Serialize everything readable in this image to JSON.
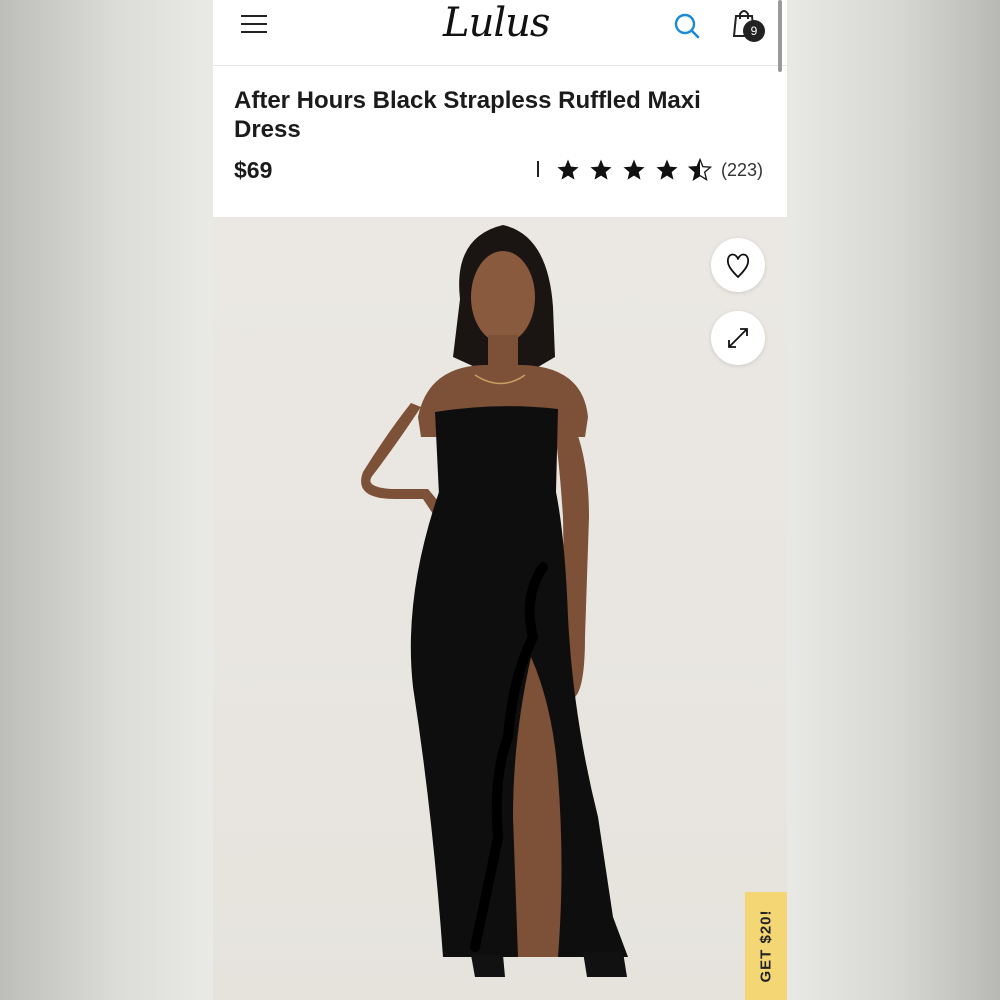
{
  "header": {
    "logo_text": "Lulus",
    "menu_icon": "hamburger-menu-icon",
    "search_icon": "search-icon",
    "bag_icon": "shopping-bag-icon",
    "bag_count": "9",
    "accent_color": "#1a8ad4"
  },
  "product": {
    "title": "After Hours Black Strapless Ruffled Maxi Dress",
    "price": "$69",
    "rating": 4.5,
    "rating_max": 5,
    "review_count": "(223)"
  },
  "image_actions": {
    "wishlist_icon": "heart-outline-icon",
    "expand_icon": "expand-arrows-icon"
  },
  "promo": {
    "label": "GET $20!",
    "color": "#f4d774"
  }
}
